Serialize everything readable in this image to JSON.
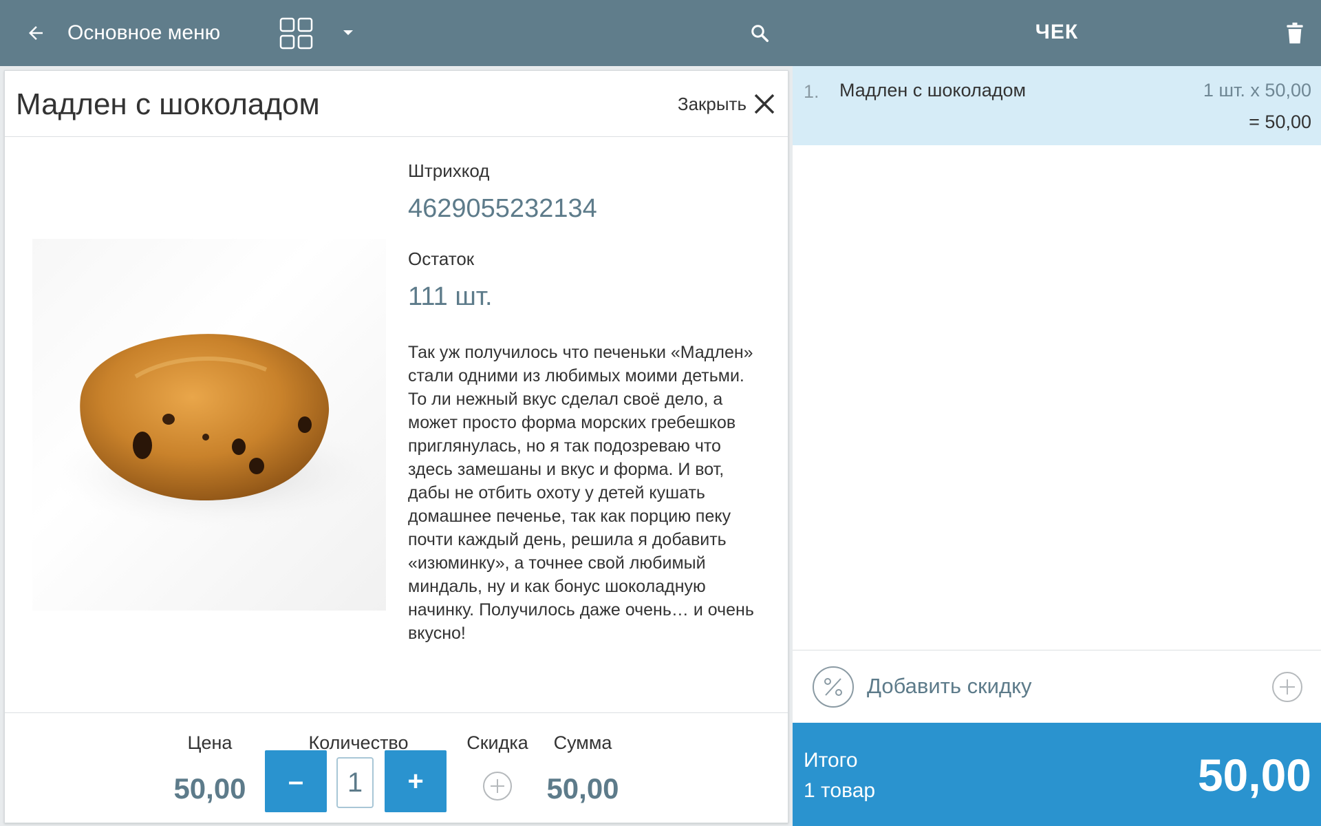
{
  "topbar": {
    "title": "Основное меню",
    "cheque_title": "ЧЕК",
    "icons": {
      "back": "arrow-left-icon",
      "grid": "grid-view-icon",
      "dropdown": "caret-down-icon",
      "search": "search-icon",
      "trash": "trash-icon"
    }
  },
  "product": {
    "title": "Мадлен с шоколадом",
    "close_label": "Закрыть",
    "barcode_label": "Штрихкод",
    "barcode": "4629055232134",
    "stock_label": "Остаток",
    "stock": "111 шт.",
    "description": "Так уж получилось что печеньки «Мадлен» стали одними из любимых моими детьми. То ли нежный вкус сделал своё дело, а может просто форма морских гребешков приглянулась, но я так подозреваю что здесь замешаны и вкус и форма. И вот, дабы не отбить охоту у детей кушать домашнее печенье, так как порцию пеку почти каждый день, решила я добавить «изюминку», а точнее свой любимый миндаль, ну и как бонус шоколадную начинку. Получилось даже очень… и очень вкусно!"
  },
  "footer": {
    "price_label": "Цена",
    "price": "50,00",
    "quantity_label": "Количество",
    "minus": "–",
    "quantity": "1",
    "plus": "+",
    "discount_label": "Скидка",
    "sum_label": "Сумма",
    "sum": "50,00"
  },
  "receipt": {
    "items": [
      {
        "num": "1.",
        "name": "Мадлен с шоколадом",
        "qty_price": "1 шт. x 50,00",
        "line_sum": "= 50,00"
      }
    ],
    "add_discount": "Добавить скидку",
    "total_label": "Итого",
    "total_count": "1 товар",
    "total_amount": "50,00"
  },
  "colors": {
    "topbar": "#607d8b",
    "accent": "#2a93cf",
    "selected_row": "#d6ecf7",
    "muted_text": "#5d7b8a"
  }
}
